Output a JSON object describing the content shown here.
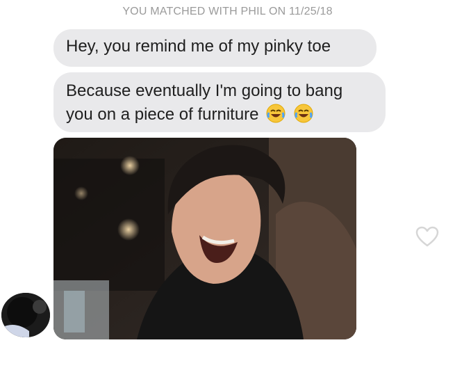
{
  "chat": {
    "match_header": "YOU MATCHED WITH PHIL ON 11/25/18",
    "messages": [
      {
        "text": "Hey, you remind me of my pinky toe"
      },
      {
        "line1": "Because eventually I'm going to bang",
        "line2": "you on a piece of furniture",
        "emojis": [
          "face-with-tears-of-joy",
          "face-with-tears-of-joy"
        ]
      }
    ],
    "photo": {
      "kind": "gif-image",
      "subject": "laughing man"
    },
    "icons": {
      "like": "heart-outline-icon",
      "avatar": "user-avatar"
    }
  },
  "colors": {
    "bubble": "#e9e9eb",
    "header_text": "#9a9a9a",
    "heart_stroke": "#d6d6d6"
  }
}
